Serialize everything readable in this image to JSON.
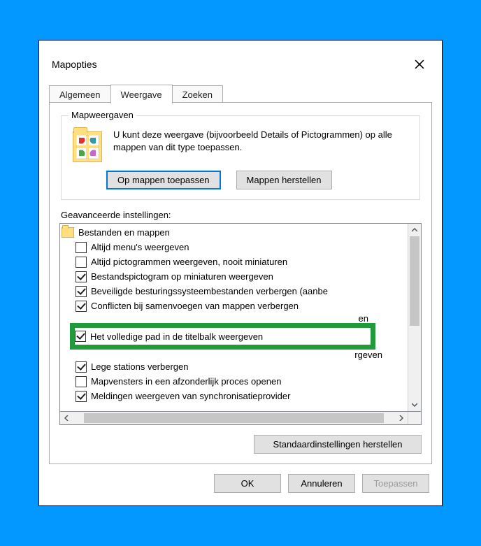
{
  "window": {
    "title": "Mapopties"
  },
  "tabs": {
    "general": "Algemeen",
    "view": "Weergave",
    "search": "Zoeken"
  },
  "groupbox": {
    "legend": "Mapweergaven",
    "description": "U kunt deze weergave (bijvoorbeeld Details of Pictogrammen) op alle mappen van dit type toepassen.",
    "apply_button": "Op mappen toepassen",
    "reset_button": "Mappen herstellen"
  },
  "advanced": {
    "label": "Geavanceerde instellingen:",
    "root_label": "Bestanden en mappen",
    "items": [
      {
        "label": "Altijd menu's weergeven",
        "checked": false
      },
      {
        "label": "Altijd pictogrammen weergeven, nooit miniaturen",
        "checked": false
      },
      {
        "label": "Bestandspictogram op miniaturen weergeven",
        "checked": true
      },
      {
        "label": "Beveiligde besturingssysteembestanden verbergen (aanbe",
        "checked": true
      },
      {
        "label": "Conflicten bij samenvoegen van mappen verbergen",
        "checked": true
      },
      {
        "label_tail_first": "en",
        "checked": false,
        "hidden_top": true
      },
      {
        "label": "Het volledige pad in de titelbalk weergeven",
        "checked": true,
        "highlighted": true
      },
      {
        "label_tail": "rgeven",
        "checked_tail": true,
        "hidden_bottom": true
      },
      {
        "label": "Lege stations verbergen",
        "checked": true
      },
      {
        "label": "Mapvensters in een afzonderlijk proces openen",
        "checked": false
      },
      {
        "label": "Meldingen weergeven van synchronisatieprovider",
        "checked": true
      }
    ],
    "restore_defaults": "Standaardinstellingen herstellen"
  },
  "footer": {
    "ok": "OK",
    "cancel": "Annuleren",
    "apply": "Toepassen"
  }
}
